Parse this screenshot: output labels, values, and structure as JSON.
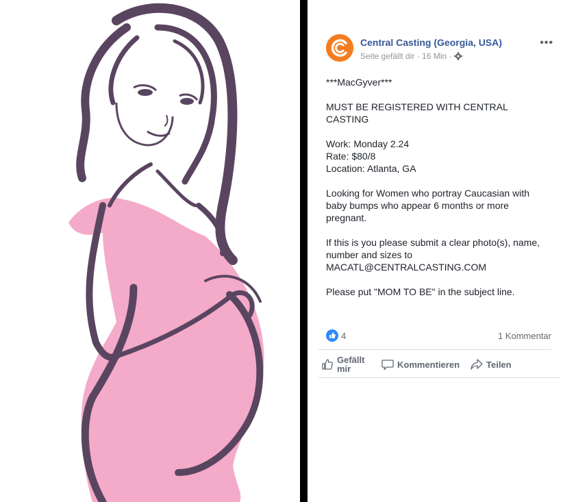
{
  "post": {
    "page_name": "Central Casting (Georgia, USA)",
    "meta_text": "Seite gefällt dir · 16 Min ·",
    "more_label": "•••",
    "body": [
      "***MacGyver***",
      "MUST BE REGISTERED WITH CENTRAL CASTING",
      "Work: Monday 2.24",
      "Rate: $80/8",
      "Location: Atlanta, GA",
      "Looking for Women who portray Caucasian with baby bumps who appear 6 months or more pregnant.",
      "If this is you please submit a clear photo(s), name, number and sizes to MACATL@CENTRALCASTING.COM",
      "Please put \"MOM TO BE\" in the subject line."
    ],
    "like_count": "4",
    "comment_count": "1 Kommentar",
    "actions": {
      "like": "Gefällt mir",
      "comment": "Kommentieren",
      "share": "Teilen"
    }
  },
  "colors": {
    "brand": "#f47c20",
    "link": "#365899",
    "like_blue": "#2d88ff",
    "illustration_pink": "#f4aac9",
    "illustration_outline": "#5a4560"
  },
  "icons": [
    "central-casting-logo-icon",
    "gear-icon",
    "like-badge-icon",
    "thumbs-up-icon",
    "comment-icon",
    "share-icon"
  ]
}
